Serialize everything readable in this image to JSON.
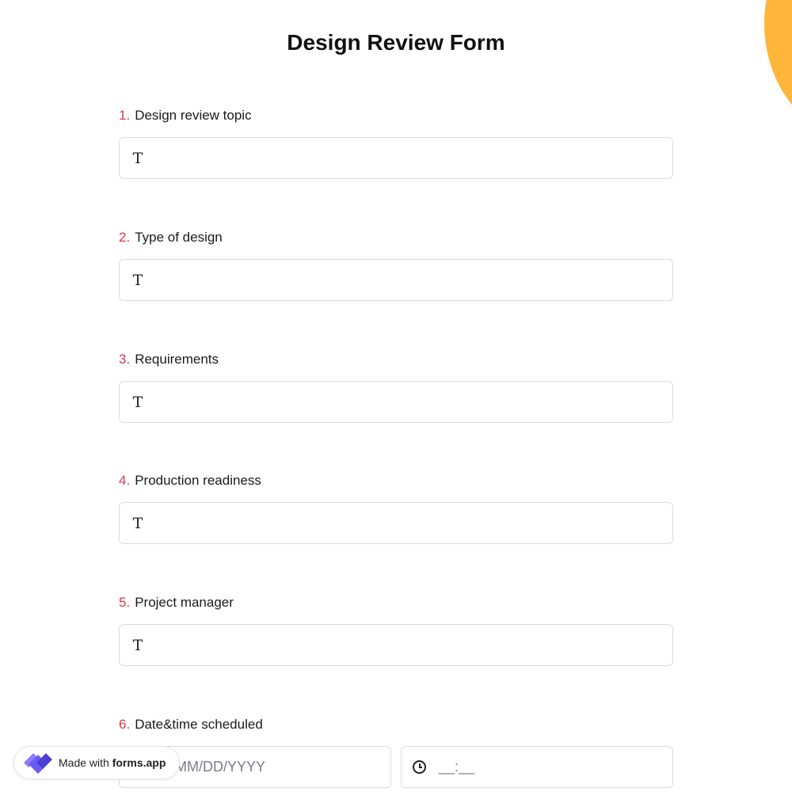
{
  "form": {
    "title": "Design Review Form"
  },
  "questions": [
    {
      "number": "1.",
      "label": "Design review topic",
      "value": ""
    },
    {
      "number": "2.",
      "label": "Type of design",
      "value": ""
    },
    {
      "number": "3.",
      "label": "Requirements",
      "value": ""
    },
    {
      "number": "4.",
      "label": "Production readiness",
      "value": ""
    },
    {
      "number": "5.",
      "label": "Project manager",
      "value": ""
    }
  ],
  "datetime": {
    "number": "6.",
    "label": "Date&time scheduled",
    "date_placeholder": "MM/DD/YYYY",
    "time_placeholder": "__:__"
  },
  "badge": {
    "prefix": "Made with",
    "brand": "forms.app"
  },
  "icons": {
    "text_field": "text-type-icon",
    "time": "clock-icon",
    "brand": "forms-app-logo-icon"
  },
  "colors": {
    "accent_number": "#e0344c",
    "decor_blob": "#ffb53a",
    "logo": "#6a5cf2"
  }
}
